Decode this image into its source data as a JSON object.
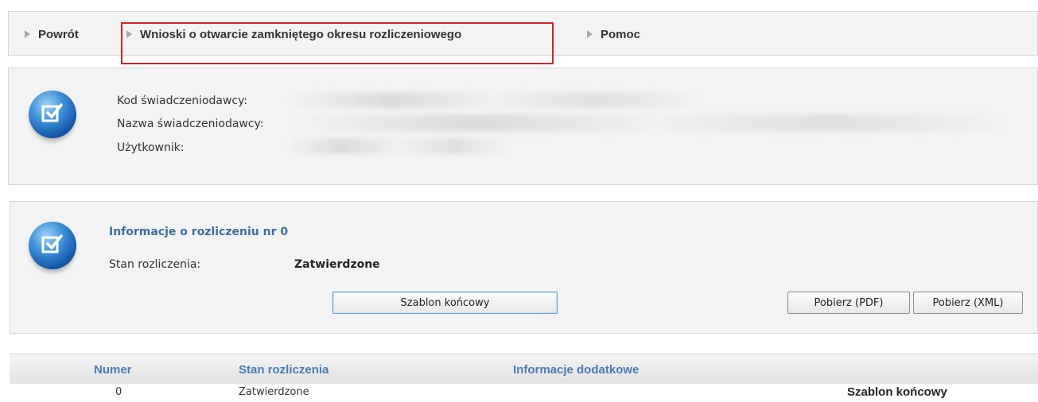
{
  "nav": {
    "back_label": "Powrót",
    "requests_label": "Wnioski o otwarcie zamkniętego okresu rozliczeniowego",
    "help_label": "Pomoc",
    "highlight_color": "#d32027"
  },
  "provider": {
    "code_label": "Kod świadczeniodawcy:",
    "name_label": "Nazwa świadczeniodawcy:",
    "user_label": "Użytkownik:",
    "icon": "document-check-icon"
  },
  "settlement": {
    "title": "Informacje o rozliczeniu nr 0",
    "status_label": "Stan rozliczenia:",
    "status_value": "Zatwierdzone",
    "icon": "document-check-icon",
    "template_button": "Szablon końcowy",
    "pdf_button": "Pobierz (PDF)",
    "xml_button": "Pobierz (XML)"
  },
  "table": {
    "headers": [
      "Numer",
      "Stan rozliczenia",
      "Informacje dodatkowe"
    ],
    "rows": [
      {
        "number": "0",
        "status": "Zatwierdzone",
        "info": "",
        "action": "Szablon końcowy"
      }
    ]
  },
  "colors": {
    "panel_bg": "#f3f3f3",
    "accent_blue": "#3b6ea5",
    "header_blue": "#4a7bb3"
  }
}
